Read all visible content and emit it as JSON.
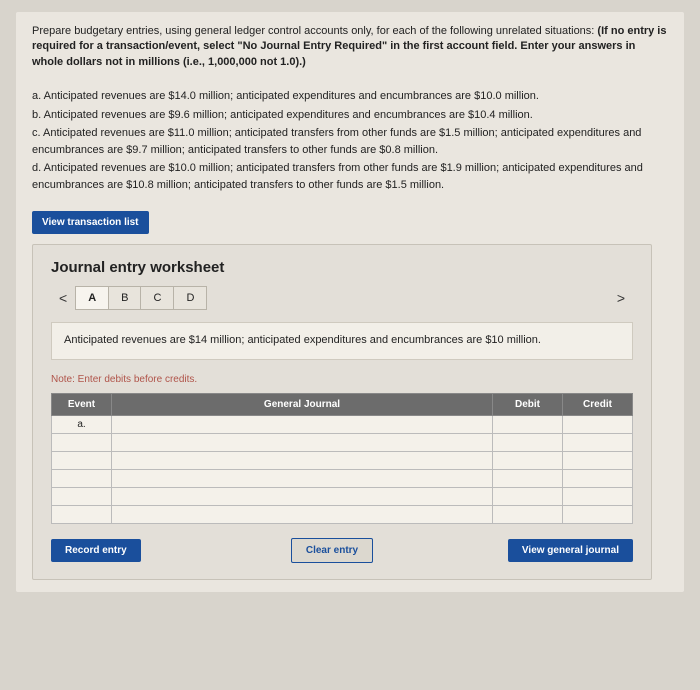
{
  "instructions": {
    "part1": "Prepare budgetary entries, using general ledger control accounts only, for each of the following unrelated situations: ",
    "bold": "(If no entry is required for a transaction/event, select \"No Journal Entry Required\" in the first account field. Enter your answers in whole dollars not in millions (i.e., 1,000,000 not 1.0).)"
  },
  "situations": [
    "a. Anticipated revenues are $14.0 million; anticipated expenditures and encumbrances are $10.0 million.",
    "b. Anticipated revenues are $9.6 million; anticipated expenditures and encumbrances are $10.4 million.",
    "c. Anticipated revenues are $11.0 million; anticipated transfers from other funds are $1.5 million; anticipated expenditures and encumbrances are $9.7 million; anticipated transfers to other funds are $0.8 million.",
    "d. Anticipated revenues are $10.0 million; anticipated transfers from other funds are $1.9 million; anticipated expenditures and encumbrances are $10.8 million; anticipated transfers to other funds are $1.5 million."
  ],
  "viewTxBtn": "View transaction list",
  "worksheet": {
    "title": "Journal entry worksheet",
    "navPrev": "<",
    "navNext": ">",
    "tabs": [
      "A",
      "B",
      "C",
      "D"
    ],
    "scenarioText": "Anticipated revenues are $14 million; anticipated expenditures and encumbrances are $10 million.",
    "note": "Note: Enter debits before credits.",
    "headers": {
      "event": "Event",
      "journal": "General Journal",
      "debit": "Debit",
      "credit": "Credit"
    },
    "rows": [
      {
        "event": "a.",
        "journal": "",
        "debit": "",
        "credit": ""
      },
      {
        "event": "",
        "journal": "",
        "debit": "",
        "credit": ""
      },
      {
        "event": "",
        "journal": "",
        "debit": "",
        "credit": ""
      },
      {
        "event": "",
        "journal": "",
        "debit": "",
        "credit": ""
      },
      {
        "event": "",
        "journal": "",
        "debit": "",
        "credit": ""
      },
      {
        "event": "",
        "journal": "",
        "debit": "",
        "credit": ""
      }
    ],
    "buttons": {
      "record": "Record entry",
      "clear": "Clear entry",
      "view": "View general journal"
    }
  }
}
